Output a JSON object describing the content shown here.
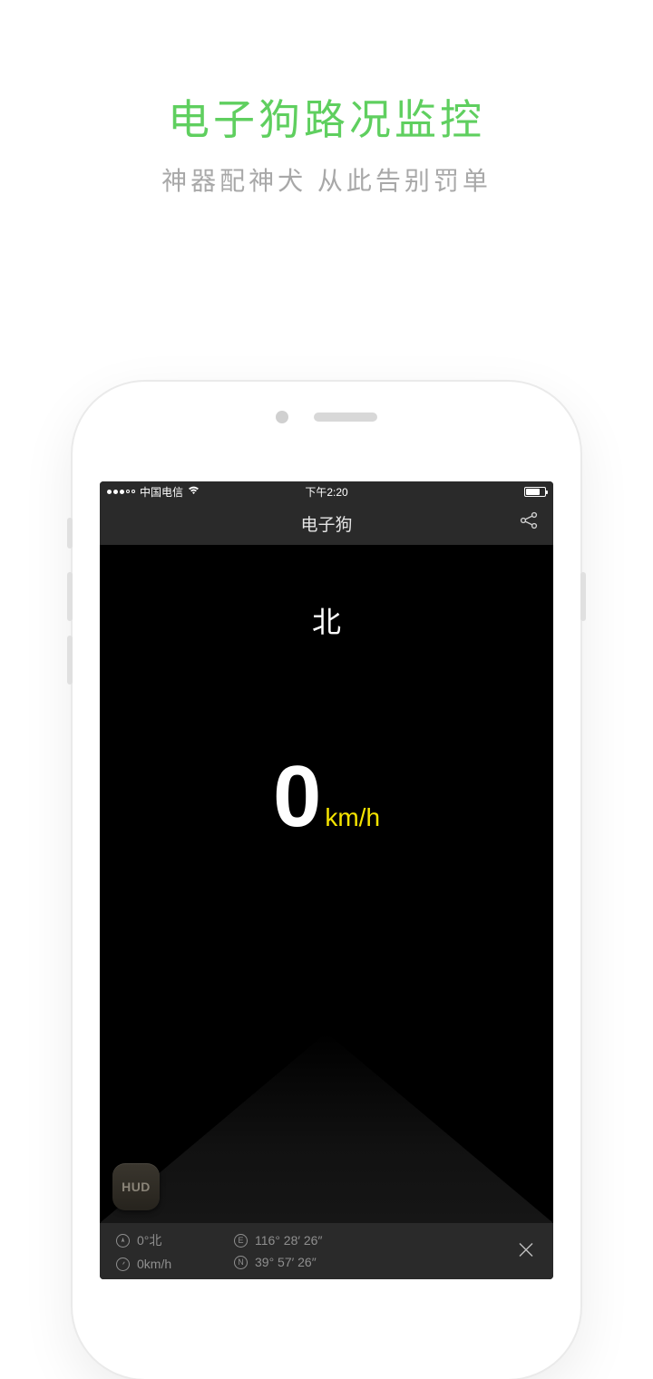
{
  "promo": {
    "title": "电子狗路况监控",
    "subtitle": "神器配神犬  从此告别罚单"
  },
  "statusBar": {
    "carrier": "中国电信",
    "time": "下午2:20"
  },
  "navBar": {
    "title": "电子狗"
  },
  "main": {
    "direction": "北",
    "speed_value": "0",
    "speed_unit": "km/h",
    "hud_label": "HUD"
  },
  "infoBar": {
    "heading": "0°北",
    "speed": "0km/h",
    "longitude": "116° 28′ 26″",
    "latitude": "39° 57′ 26″",
    "east_label": "E",
    "north_label": "N"
  }
}
